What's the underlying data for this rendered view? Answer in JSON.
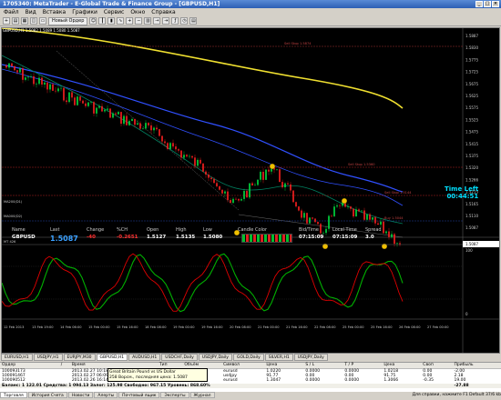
{
  "window": {
    "title": "1705340: MetaTrader - E-Global Trade & Finance Group - [GBPUSD,H1]"
  },
  "menu": [
    "Файл",
    "Вид",
    "Вставка",
    "Графики",
    "Сервис",
    "Окно",
    "Справка"
  ],
  "toolbar": {
    "new_order": "Новый Ордер"
  },
  "chart": {
    "symbol_header": "GBPUSD,H1  1.5082 1.5089 1.5080 1.5087",
    "price_labels": [
      "1.5887",
      "1.5830",
      "1.5775",
      "1.5725",
      "1.5675",
      "1.5625",
      "1.5575",
      "1.5525",
      "1.5475",
      "1.5415",
      "1.5375",
      "1.5320",
      "1.5266",
      "1.5215",
      "1.5165",
      "1.5110",
      "1.5087"
    ],
    "line_labels": [
      "Sell Stop 1.5874",
      "Sell Stop 1.5360",
      "Sell Stop 1.5144",
      "Buy 1.5044"
    ],
    "indicator_labels": [
      "MA200(D1)",
      "MA000(D2)"
    ],
    "osc_header": "MT 426",
    "osc_labels": [
      "100",
      "0"
    ],
    "date_labels": [
      "12 Feb 2013",
      "13 Feb 19:00",
      "14 Feb 06:00",
      "15 Feb 00:00",
      "15 Feb 16:00",
      "18 Feb 08:00",
      "19 Feb 00:00",
      "19 Feb 16:00",
      "20 Feb 08:00",
      "21 Feb 00:00",
      "21 Feb 16:00",
      "22 Feb 08:00",
      "25 Feb 00:00",
      "25 Feb 16:00",
      "26 Feb 08:00",
      "27 Feb 00:00"
    ],
    "colors": {
      "bull": "#00e040",
      "bear": "#ff2020",
      "ma_yellow": "#f0e030",
      "ma_blue": "#3050ff",
      "ma_green": "#008060",
      "osc_green": "#00b000",
      "osc_red": "#e00000"
    }
  },
  "time_left": {
    "label": "Time Left",
    "value": "00:44:51"
  },
  "quote": {
    "headers": [
      "Name",
      "Last",
      "Change",
      "%CH",
      "Open",
      "High",
      "Low",
      "Candle Color",
      "Bid/Time",
      "Local Time",
      "Spread"
    ],
    "values": [
      "GBPUSD",
      "1.5087",
      "-40",
      "-0.2651",
      "1.5127",
      "1.5135",
      "1.5080",
      "",
      "07:15:09",
      "07:15:09",
      "3.0"
    ]
  },
  "chart_tabs": [
    "EURUSD,H1",
    "USDJPY,H1",
    "EURJPY,M30",
    "GBPUSD,H1",
    "AUDUSD,H1",
    "USDCHF,Daily",
    "USDJPY,Daily",
    "GOLD,Daily",
    "SILVER,H1",
    "USDJPY,Daily"
  ],
  "terminal": {
    "headers": [
      "Ордер",
      "/",
      "Время",
      "Тип",
      "Объём",
      "Символ",
      "Цена",
      "S / L",
      "T / P",
      "Цена",
      "Своп",
      "Прибыль"
    ],
    "rows": [
      [
        "100093173",
        "",
        "2013.02.27 10:18",
        "buy",
        "0.02",
        "eurusd",
        "1.0220",
        "0.0000",
        "0.0000",
        "1.0218",
        "0.00",
        "-2.00"
      ],
      [
        "100091467",
        "",
        "2013.02.27 06:09",
        "sell",
        "0.10",
        "usdjpy",
        "91.77",
        "0.00",
        "0.00",
        "91.75",
        "0.00",
        "2.18"
      ],
      [
        "100090512",
        "",
        "2013.02.26 16:14",
        "buy",
        "0.10",
        "eurusd",
        "1.3047",
        "0.0000",
        "0.0000",
        "1.3066",
        "-0.35",
        "19.00"
      ]
    ],
    "balance": "Баланс: 1 122.01  Средства: 1 094.13  Залог: 125.98  Свободно: 967.15  Уровень: 868.60%",
    "balance_profit": "-27.88",
    "tooltip": "Great Britain Pound vs US Dollar\n258 Ворсм., последняя цена: 1.5087"
  },
  "terminal_tabs": [
    "Торговля",
    "История Счета",
    "Новости",
    "Алерты",
    "Почтовый ящик",
    "Эксперты",
    "Журнал"
  ],
  "status": {
    "left": "Для справки, нажмите F1",
    "middle": "Default",
    "right": "37/6 kb"
  }
}
